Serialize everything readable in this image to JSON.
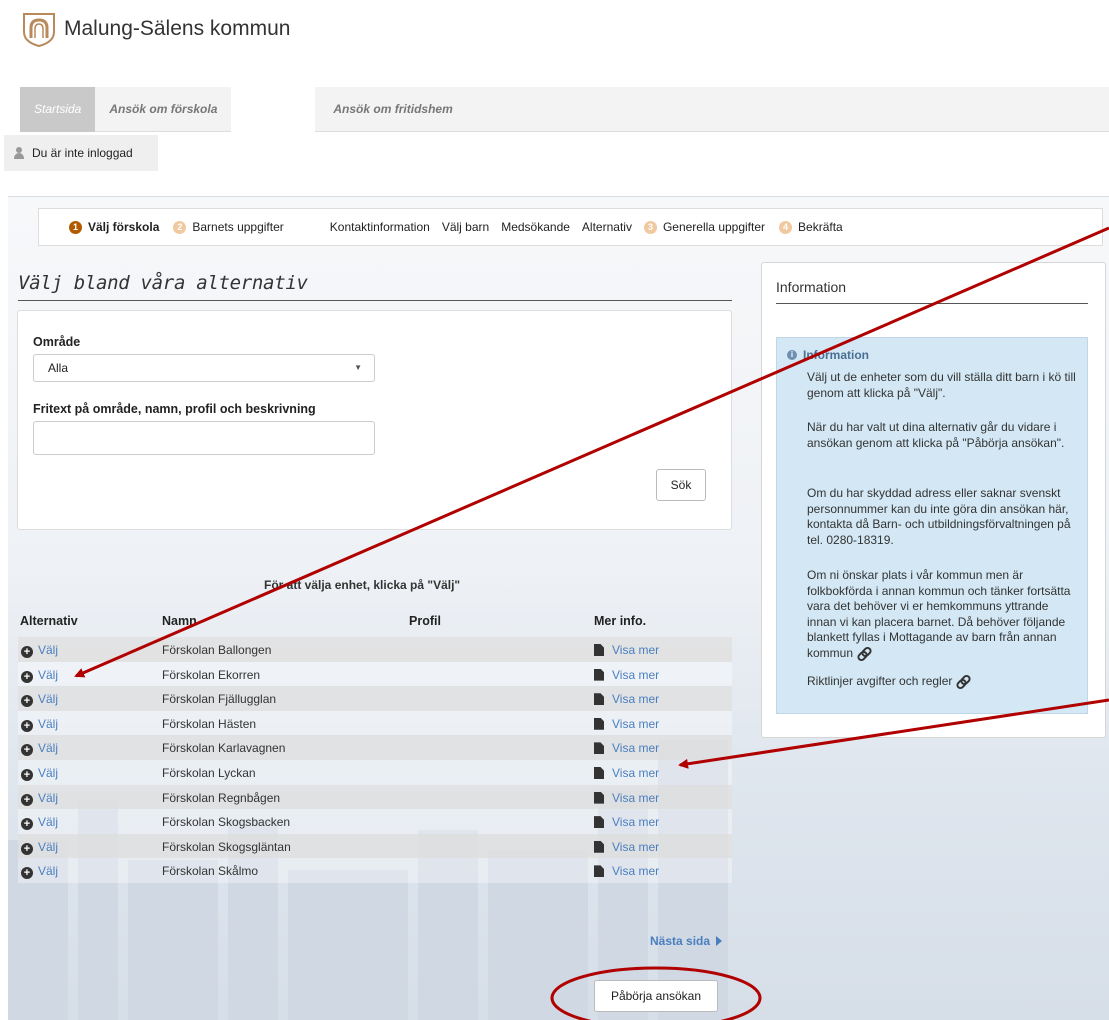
{
  "header": {
    "municipality": "Malung-Sälens kommun"
  },
  "nav": {
    "tabs": [
      {
        "label": "Startsida"
      },
      {
        "label": "Ansök om förskola"
      },
      {
        "label": "Ansök om fritidshem"
      }
    ]
  },
  "login": {
    "status": "Du är inte inloggad"
  },
  "steps": [
    {
      "num": "1",
      "label": "Välj förskola"
    },
    {
      "num": "2",
      "label": "Barnets uppgifter"
    },
    {
      "label": "Kontaktinformation"
    },
    {
      "label": "Välj barn"
    },
    {
      "label": "Medsökande"
    },
    {
      "label": "Alternativ"
    },
    {
      "num": "3",
      "label": "Generella uppgifter"
    },
    {
      "num": "4",
      "label": "Bekräfta"
    }
  ],
  "left": {
    "title": "Välj bland våra alternativ",
    "area_label": "Område",
    "area_value": "Alla",
    "freetext_label": "Fritext på område, namn, profil och beskrivning",
    "freetext_value": "",
    "search_button": "Sök",
    "hint": "För att välja enhet, klicka på \"Välj\""
  },
  "table": {
    "headers": {
      "alternative": "Alternativ",
      "name": "Namn",
      "profile": "Profil",
      "more": "Mer info."
    },
    "choose_label": "Välj",
    "more_label": "Visa mer",
    "rows": [
      {
        "name": "Förskolan Ballongen",
        "profile": ""
      },
      {
        "name": "Förskolan Ekorren",
        "profile": ""
      },
      {
        "name": "Förskolan Fjällugglan",
        "profile": ""
      },
      {
        "name": "Förskolan Hästen",
        "profile": ""
      },
      {
        "name": "Förskolan Karlavagnen",
        "profile": ""
      },
      {
        "name": "Förskolan Lyckan",
        "profile": ""
      },
      {
        "name": "Förskolan Regnbågen",
        "profile": ""
      },
      {
        "name": "Förskolan Skogsbacken",
        "profile": ""
      },
      {
        "name": "Förskolan Skogsgläntan",
        "profile": ""
      },
      {
        "name": "Förskolan Skålmo",
        "profile": ""
      }
    ],
    "next_page": "Nästa sida",
    "start_button": "Påbörja ansökan"
  },
  "info": {
    "panel_title": "Information",
    "box_title": "Information",
    "paragraphs": [
      "Välj ut de enheter som du vill ställa ditt barn i kö till genom att klicka på \"Välj\".",
      "När du har valt ut dina alternativ går du vidare i ansökan genom att klicka på \"Påbörja ansökan\".",
      "Om du har skyddad adress eller saknar svenskt personnummer kan du inte göra din ansökan här, kontakta då Barn- och utbildningsförvaltningen på tel. 0280-18319.",
      "Om ni önskar plats i vår kommun men är folkbokförda i annan kommun och tänker fortsätta vara det behöver vi er hemkommuns yttrande innan vi kan placera barnet. Då behöver följande blankett fyllas i Mottagande av barn från annan kommun",
      "Riktlinjer avgifter och regler"
    ]
  },
  "colors": {
    "accent": "#b35a00",
    "link": "#4a7fbf",
    "info_bg": "#d3e8f4",
    "annotation": "#b00000"
  },
  "icons": {
    "logo": "horseshoe-crest-icon",
    "user": "user-icon",
    "plus": "plus-circle-icon",
    "doc": "document-icon",
    "link": "chain-link-icon",
    "next": "triangle-right-icon",
    "info": "info-circle-icon"
  }
}
